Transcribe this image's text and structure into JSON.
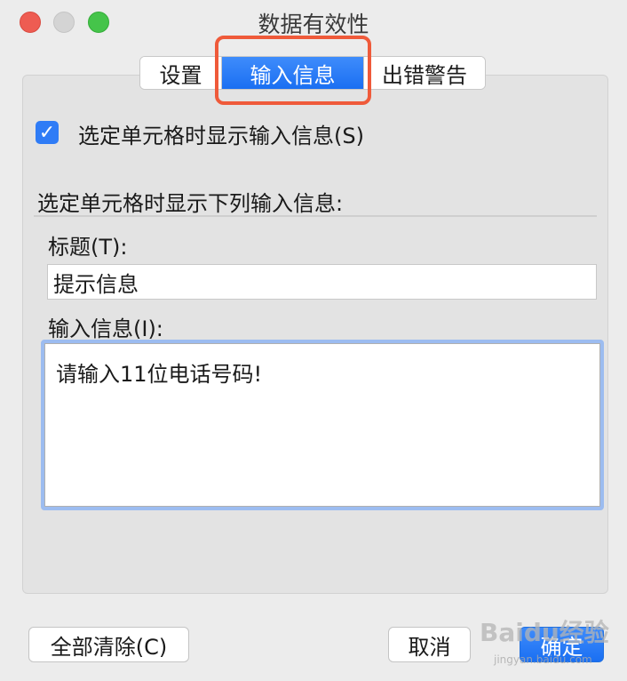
{
  "window": {
    "title": "数据有效性"
  },
  "tabs": [
    {
      "label": "设置"
    },
    {
      "label": "输入信息",
      "active": true
    },
    {
      "label": "出错警告"
    }
  ],
  "checkbox": {
    "checked": true,
    "label": "选定单元格时显示输入信息(S)"
  },
  "section": {
    "label": "选定单元格时显示下列输入信息:"
  },
  "title_field": {
    "label": "标题(T):",
    "value": "提示信息"
  },
  "message_field": {
    "label": "输入信息(I):",
    "value": "请输入11位电话号码!"
  },
  "buttons": {
    "clear": "全部清除(C)",
    "cancel": "取消",
    "ok": "确定"
  },
  "watermark": {
    "text": "Baidu经验",
    "sub": "jingyan.baidu.com"
  },
  "colors": {
    "accent": "#1a6ff2",
    "highlight_box": "#ef5a3a"
  }
}
